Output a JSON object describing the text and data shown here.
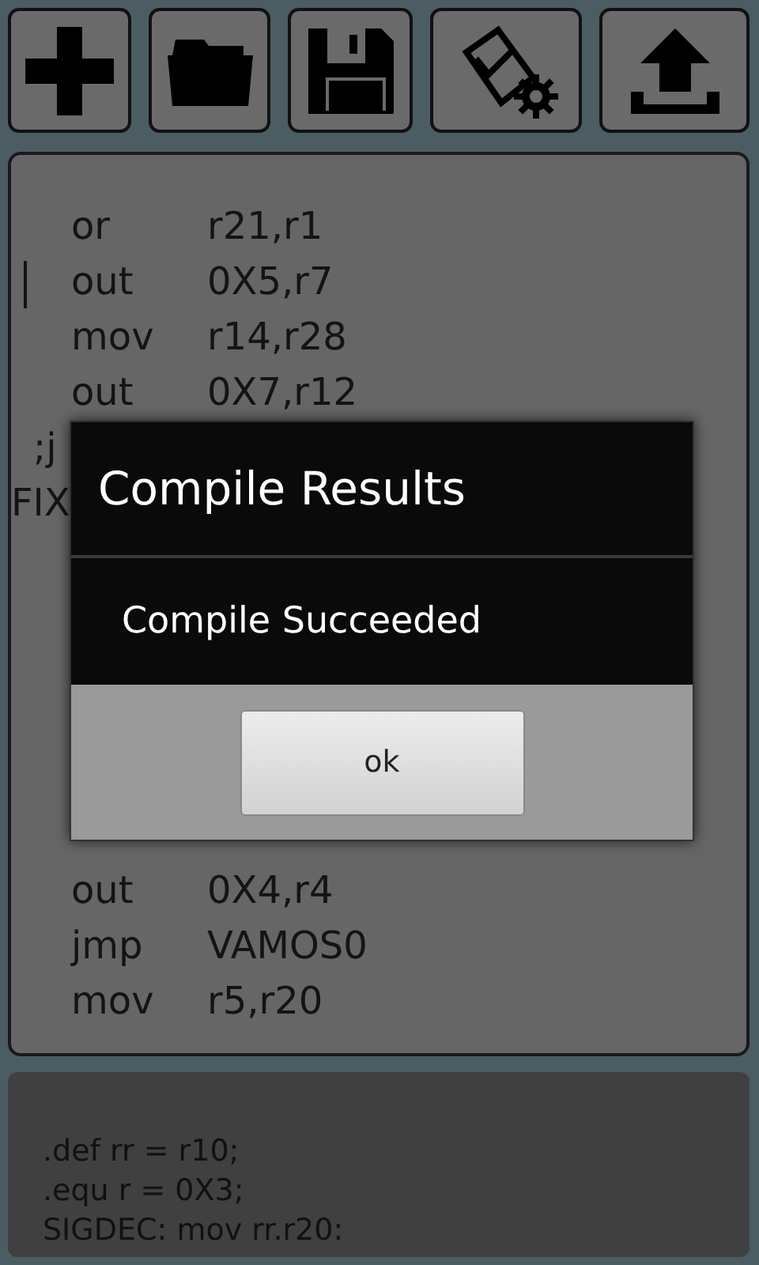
{
  "toolbar": {
    "buttons": [
      {
        "kind": "plus"
      },
      {
        "kind": "folder"
      },
      {
        "kind": "floppy"
      },
      {
        "kind": "scroll-gear"
      },
      {
        "kind": "upload"
      }
    ]
  },
  "editor": {
    "lines_above": [
      {
        "op": "or",
        "args": "r21,r1",
        "cursor": false
      },
      {
        "op": "out",
        "args": "0X5,r7",
        "cursor": true
      },
      {
        "op": "mov",
        "args": "r14,r28",
        "cursor": false
      },
      {
        "op": "out",
        "args": "0X7,r12",
        "cursor": false
      }
    ],
    "fragments": [
      ";j",
      "FIX"
    ],
    "lines_below": [
      {
        "op": "out",
        "args": "0X4,r4",
        "cursor": false
      },
      {
        "op": "jmp",
        "args": "VAMOS0",
        "cursor": false
      },
      {
        "op": "mov",
        "args": "r5,r20",
        "cursor": false
      }
    ]
  },
  "dialog": {
    "title": "Compile Results",
    "message": "Compile Succeeded",
    "button": "ok"
  },
  "console": {
    "lines": [
      ".def rr = r10;",
      ".equ r = 0X3;",
      "SIGDEC: mov rr.r20:"
    ]
  }
}
